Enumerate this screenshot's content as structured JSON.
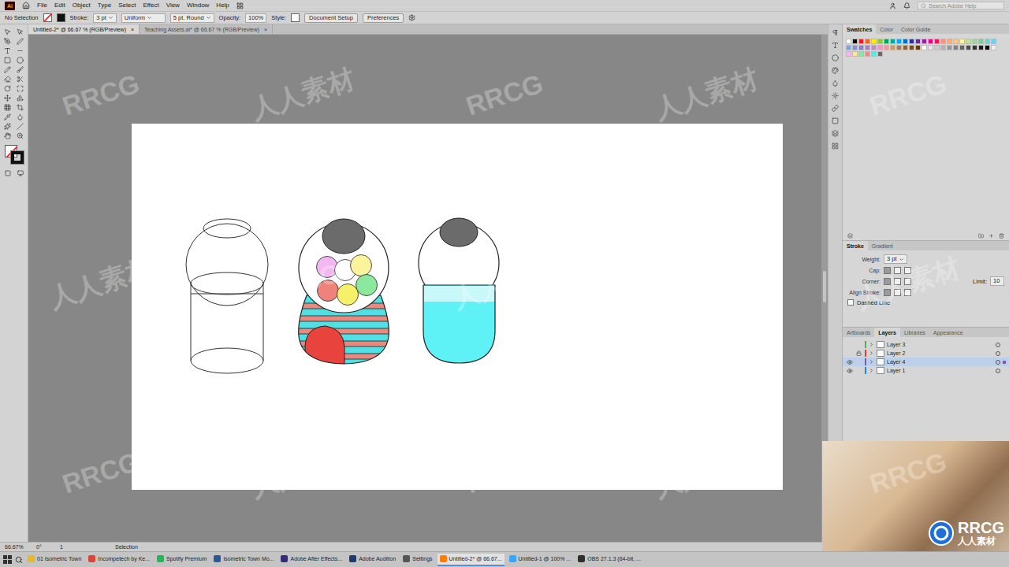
{
  "app": {
    "logo": "Ai",
    "menus": [
      "File",
      "Edit",
      "Object",
      "Type",
      "Select",
      "Effect",
      "View",
      "Window",
      "Help"
    ],
    "search_placeholder": "Search Adobe Help"
  },
  "control_bar": {
    "selection": "No Selection",
    "stroke_label": "Stroke:",
    "stroke_weight": "3 pt",
    "profile": "Uniform",
    "brush": "5 pt. Round",
    "opacity_label": "Opacity:",
    "opacity": "100%",
    "style_label": "Style:",
    "buttons": [
      "Document Setup",
      "Preferences"
    ]
  },
  "document_tabs": [
    {
      "label": "Untitled-2* @ 66.67 % (RGB/Preview)",
      "close": "×",
      "selected": true
    },
    {
      "label": "Teaching Assets.ai* @ 66.67 % (RGB/Preview)",
      "close": "×",
      "selected": false
    }
  ],
  "artwork": {
    "gumballs": [
      {
        "color": "#f3b8f1"
      },
      {
        "color": "#ffffff"
      },
      {
        "color": "#fbf49c"
      },
      {
        "color": "#8be89d"
      },
      {
        "color": "#f0827c"
      },
      {
        "color": "#f7f06a"
      }
    ]
  },
  "swatches_panel": {
    "tabs": [
      {
        "label": "Swatches",
        "selected": true
      },
      {
        "label": "Color",
        "selected": false
      },
      {
        "label": "Color Guide",
        "selected": false
      }
    ],
    "swatches": [
      {
        "color": "#ffffff"
      },
      {
        "color": "#000000"
      },
      {
        "color": "#ed1c24"
      },
      {
        "color": "#f26522"
      },
      {
        "color": "#fff200"
      },
      {
        "color": "#8dc63f"
      },
      {
        "color": "#00a651"
      },
      {
        "color": "#00a99d"
      },
      {
        "color": "#00aeef"
      },
      {
        "color": "#0072bc"
      },
      {
        "color": "#2e3192"
      },
      {
        "color": "#662d91"
      },
      {
        "color": "#92278f"
      },
      {
        "color": "#ec008c"
      },
      {
        "color": "#ed145b"
      },
      {
        "color": "#f7977a"
      },
      {
        "color": "#f9ad81"
      },
      {
        "color": "#fdc68a"
      },
      {
        "color": "#fff79a"
      },
      {
        "color": "#c4df9b"
      },
      {
        "color": "#a3d39c"
      },
      {
        "color": "#82ca9d"
      },
      {
        "color": "#7bcdc8"
      },
      {
        "color": "#6ecff6"
      },
      {
        "color": "#7ea7d8"
      },
      {
        "color": "#8493ca"
      },
      {
        "color": "#8882be"
      },
      {
        "color": "#a187be"
      },
      {
        "color": "#bc8dbf"
      },
      {
        "color": "#f49ac2"
      },
      {
        "color": "#f6989d"
      },
      {
        "color": "#c69c6d"
      },
      {
        "color": "#a67c52"
      },
      {
        "color": "#8c6239"
      },
      {
        "color": "#754c24"
      },
      {
        "color": "#603913"
      },
      {
        "color": "#ffffff"
      },
      {
        "color": "#e6e6e6"
      },
      {
        "color": "#cccccc"
      },
      {
        "color": "#b3b3b3"
      },
      {
        "color": "#999999"
      },
      {
        "color": "#808080"
      },
      {
        "color": "#666666"
      },
      {
        "color": "#4d4d4d"
      },
      {
        "color": "#333333"
      },
      {
        "color": "#1a1a1a"
      },
      {
        "color": "#000000"
      },
      {
        "color": "#f0f0f0"
      },
      {
        "color": "#fbb4f0"
      },
      {
        "color": "#f9e79f"
      },
      {
        "color": "#85e89d"
      },
      {
        "color": "#f08a80"
      },
      {
        "color": "#57e6ea"
      },
      {
        "color": "#6b6b6b"
      }
    ]
  },
  "stroke_panel": {
    "tabs": [
      {
        "label": "Stroke",
        "selected": true
      },
      {
        "label": "Gradient",
        "selected": false
      }
    ],
    "weight_label": "Weight:",
    "weight": "3 pt",
    "cap_label": "Cap:",
    "corner_label": "Corner:",
    "limit_label": "Limit:",
    "limit": "10",
    "align_label": "Align Stroke:",
    "dashed": {
      "label": "Dashed Line",
      "checked": false
    }
  },
  "layers_panel": {
    "tabs": [
      {
        "label": "Artboards",
        "selected": false
      },
      {
        "label": "Layers",
        "selected": true
      },
      {
        "label": "Libraries",
        "selected": false
      },
      {
        "label": "Appearance",
        "selected": false
      }
    ],
    "layers": [
      {
        "name": "Layer 3",
        "visible": false,
        "locked": false,
        "selected": false,
        "color": "#4caf50"
      },
      {
        "name": "Layer 2",
        "visible": false,
        "locked": true,
        "selected": false,
        "color": "#e53935"
      },
      {
        "name": "Layer 4",
        "visible": true,
        "locked": false,
        "selected": true,
        "color": "#7e57c2"
      },
      {
        "name": "Layer 1",
        "visible": true,
        "locked": false,
        "selected": false,
        "color": "#1e88e5"
      }
    ]
  },
  "status_bar": {
    "zoom": "66.67%",
    "rotation": "0°",
    "artboard": "1",
    "tool": "Selection"
  },
  "taskbar": {
    "items": [
      {
        "label": "01 Isometric Town",
        "color": "#e8b923",
        "selected": false
      },
      {
        "label": "Incompetech by Ke...",
        "color": "#db4437",
        "selected": false
      },
      {
        "label": "Spotify Premium",
        "color": "#1db954",
        "selected": false
      },
      {
        "label": "Isometric Town Mo...",
        "color": "#2b579a",
        "selected": false
      },
      {
        "label": "Adobe After Effects...",
        "color": "#3b2a78",
        "selected": false
      },
      {
        "label": "Adobe Audition",
        "color": "#1f3a6e",
        "selected": false
      },
      {
        "label": "Settings",
        "color": "#555555",
        "selected": false
      },
      {
        "label": "Untitled-2* @ 66.67...",
        "color": "#ff7c00",
        "selected": true
      },
      {
        "label": "Untitled-1 @ 100% ...",
        "color": "#31a8ff",
        "selected": false
      },
      {
        "label": "OBS 27.1.3 (64-bit, ...",
        "color": "#302e31",
        "selected": false
      }
    ]
  },
  "webcam": {
    "logo_title": "RRCG",
    "logo_subtitle": "人人素材"
  },
  "watermarks": [
    "RRCG",
    "人人素材",
    "RRCG",
    "人人素材",
    "RRCG",
    "人人素材",
    "RRCG",
    "人人素材",
    "RRCG",
    "人人素材",
    "RRCG",
    "人人素材",
    "RRCG",
    "人人素材",
    "RRCG"
  ]
}
